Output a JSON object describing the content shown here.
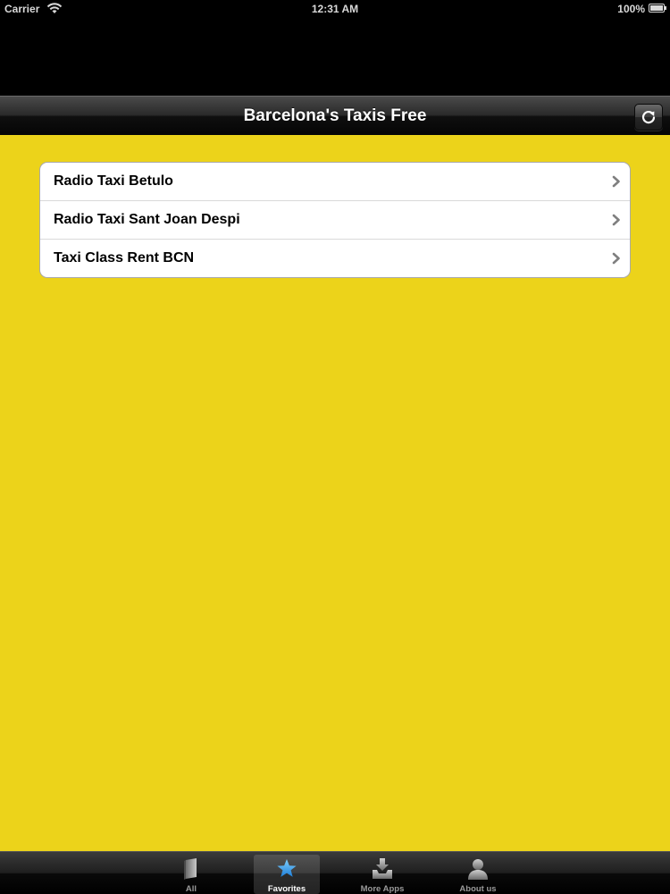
{
  "status_bar": {
    "carrier": "Carrier",
    "time": "12:31 AM",
    "battery": "100%"
  },
  "nav_bar": {
    "title": "Barcelona's Taxis Free",
    "refresh_icon": "refresh-icon"
  },
  "list": {
    "items": [
      {
        "label": "Radio Taxi Betulo"
      },
      {
        "label": "Radio Taxi Sant Joan Despi"
      },
      {
        "label": "Taxi Class Rent BCN"
      }
    ]
  },
  "tab_bar": {
    "tabs": [
      {
        "label": "All",
        "icon": "book-icon",
        "selected": false
      },
      {
        "label": "Favorites",
        "icon": "star-icon",
        "selected": true
      },
      {
        "label": "More Apps",
        "icon": "download-tray-icon",
        "selected": false
      },
      {
        "label": "About us",
        "icon": "person-icon",
        "selected": false
      }
    ]
  },
  "colors": {
    "background_yellow": "#ecd31a",
    "selected_tab_icon": "#3aa0f0"
  }
}
